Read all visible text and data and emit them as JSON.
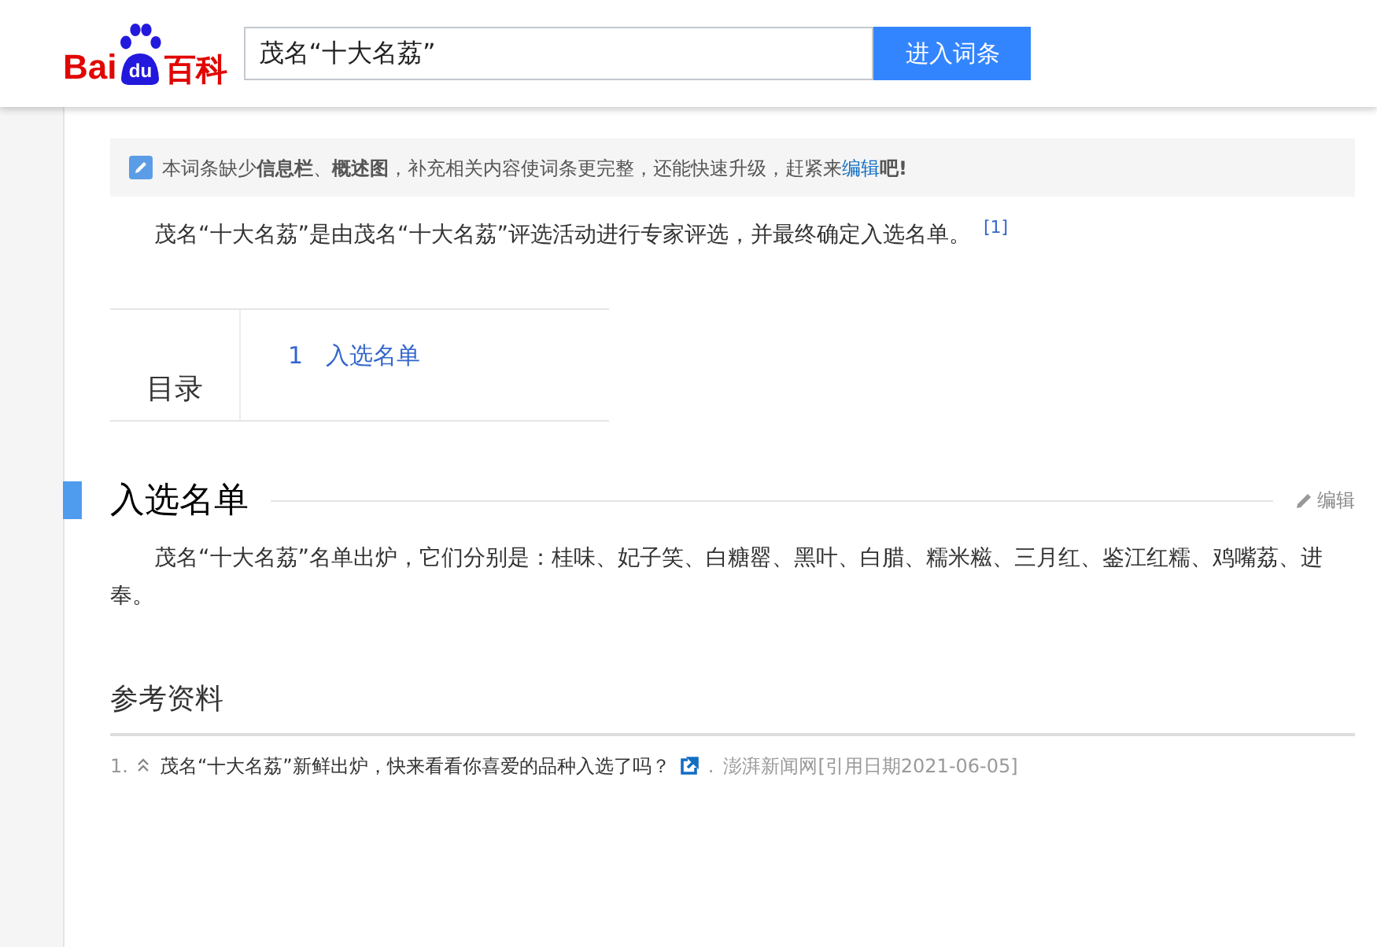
{
  "header": {
    "logo_latin": "Bai",
    "logo_badge": "du",
    "logo_cjk": "百科",
    "search": {
      "value": "茂名“十大名荔”"
    },
    "search_button": "进入词条"
  },
  "notice": {
    "text": "本词条缺少**信息栏**、**概述图**，补充相关内容使词条更完整，还能快速升级，赶紧来",
    "link": "编辑",
    "suffix": "**吧!**"
  },
  "summary": {
    "text": "茂名“十大名荔”是由茂名“十大名荔”评选活动进行专家评选，并最终确定入选名单。",
    "citation": "[1]"
  },
  "toc": {
    "title": "目录",
    "items": [
      {
        "number": "1",
        "label": "入选名单"
      }
    ]
  },
  "sections": [
    {
      "title": "入选名单",
      "edit": "编辑",
      "paragraph": "茂名“十大名荔”名单出炉，它们分别是：桂味、妃子笑、白糖罂、黑叶、白腊、糯米糍、三月红、鉴江红糯、鸡嘴荔、进奉。"
    }
  ],
  "references": {
    "title": "参考资料",
    "items": [
      {
        "number": "1.",
        "title": "茂名“十大名荔”新鲜出炉，快来看看你喜爱的品种入选了吗？",
        "dot": ".",
        "source": "澎湃新闻网",
        "cited": "[引用日期2021-06-05]"
      }
    ]
  }
}
